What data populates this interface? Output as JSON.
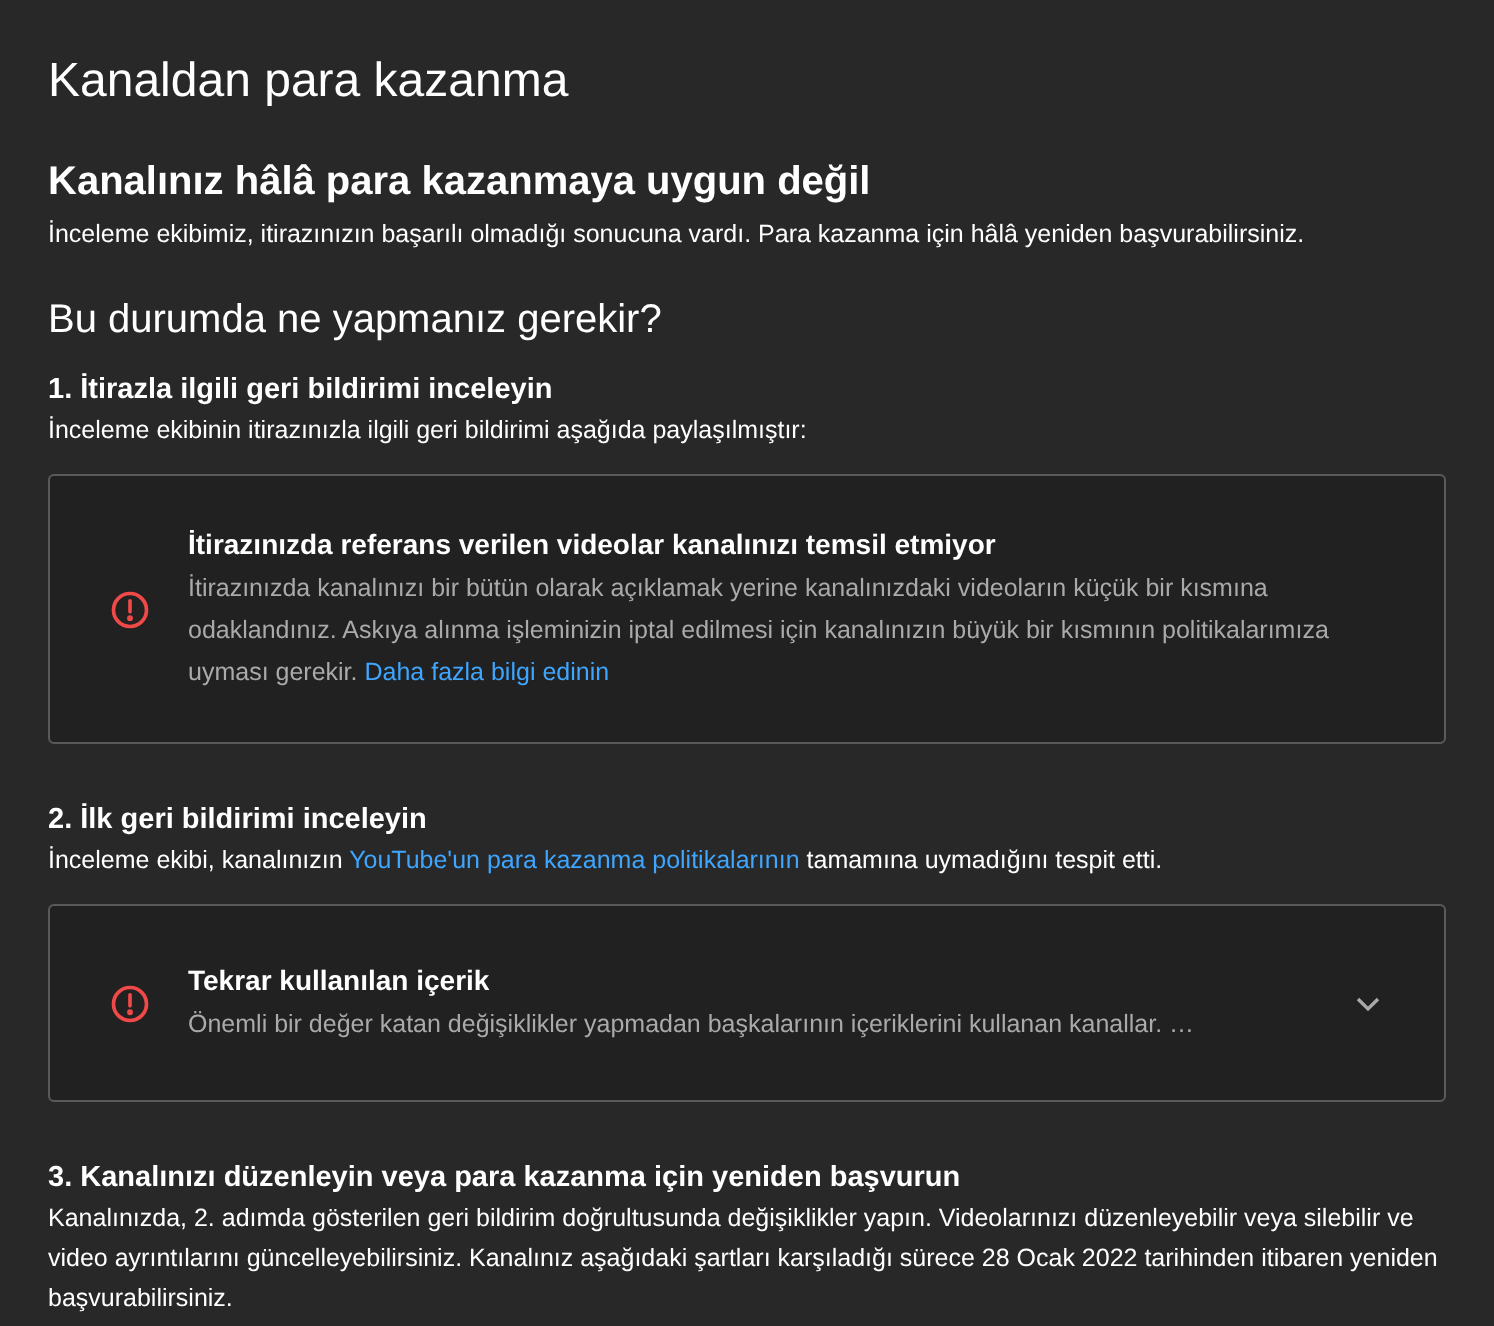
{
  "title": "Kanaldan para kazanma",
  "status": {
    "heading": "Kanalınız hâlâ para kazanmaya uygun değil",
    "text": "İnceleme ekibimiz, itirazınızın başarılı olmadığı sonucuna vardı. Para kazanma için hâlâ yeniden başvurabilirsiniz."
  },
  "next_steps": {
    "heading": "Bu durumda ne yapmanız gerekir?",
    "steps": [
      {
        "title": "1. İtirazla ilgili geri bildirimi inceleyin",
        "text": {
          "before": "İnceleme ekibinin itirazınızla ilgili geri bildirimi aşağıda paylaşılmıştır:"
        },
        "card": {
          "title": "İtirazınızda referans verilen videolar kanalınızı temsil etmiyor",
          "body": "İtirazınızda kanalınızı bir bütün olarak açıklamak yerine kanalınızdaki videoların küçük bir kısmına odaklandınız. Askıya alınma işleminizin iptal edilmesi için kanalınızın büyük bir kısmının politikalarımıza uyması gerekir.",
          "link": "Daha fazla bilgi edinin"
        }
      },
      {
        "title": "2. İlk geri bildirimi inceleyin",
        "text": {
          "before": "İnceleme ekibi, kanalınızın ",
          "link": "YouTube'un para kazanma politikalarının",
          "after": " tamamına uymadığını tespit etti."
        },
        "card": {
          "title": "Tekrar kullanılan içerik",
          "body": "Önemli bir değer katan değişiklikler yapmadan başkalarının içeriklerini kullanan kanallar. …",
          "expanded": false
        }
      },
      {
        "title": "3. Kanalınızı düzenleyin veya para kazanma için yeniden başvurun",
        "text": {
          "before": "Kanalınızda, 2. adımda gösterilen geri bildirim doğrultusunda değişiklikler yapın. Videolarınızı düzenleyebilir veya silebilir ve video ayrıntılarını güncelleyebilirsiniz. Kanalınız aşağıdaki şartları karşıladığı sürece 28 Ocak 2022 tarihinden itibaren yeniden başvurabilirsiniz."
        }
      }
    ]
  }
}
